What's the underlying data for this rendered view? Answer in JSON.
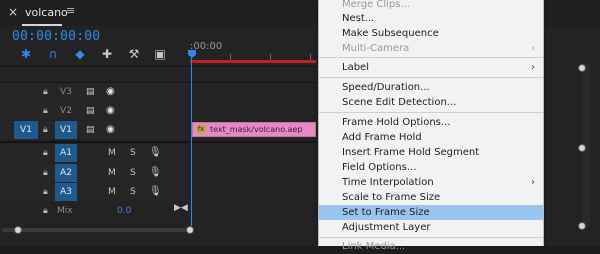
{
  "timeline": {
    "sequence_name": "volcano",
    "timecode": "00:00:00:00",
    "ruler_time": ":00:00",
    "tools": [
      {
        "name": "snap-in-timeline-icon",
        "glyph": "⚹",
        "active": true
      },
      {
        "name": "linked-selection-icon",
        "glyph": "∩",
        "active": true
      },
      {
        "name": "add-marker-icon",
        "glyph": "◆",
        "active": true
      },
      {
        "name": "timeline-display-settings-icon",
        "glyph": "⚑",
        "active": false
      },
      {
        "name": "wrench-icon",
        "glyph": "🔧",
        "active": false
      },
      {
        "name": "captions-icon",
        "glyph": "▭",
        "active": false
      }
    ],
    "video_tracks": [
      {
        "name": "V3",
        "source": "",
        "active": false
      },
      {
        "name": "V2",
        "source": "",
        "active": false
      },
      {
        "name": "V1",
        "source": "V1",
        "active": true
      }
    ],
    "audio_tracks": [
      {
        "name": "A1",
        "mute": "M",
        "solo": "S"
      },
      {
        "name": "A2",
        "mute": "M",
        "solo": "S"
      },
      {
        "name": "A3",
        "mute": "M",
        "solo": "S"
      }
    ],
    "mix_label": "Mix",
    "mix_value": "0.0",
    "clip": {
      "fx": "fx",
      "name": "text_mask/volcano.aep"
    },
    "colors": {
      "accent": "#2d8ceb",
      "clip": "#e58bc4",
      "red_bar": "#c02020"
    }
  },
  "context_menu": {
    "items": [
      {
        "label": "Merge Clips...",
        "disabled": true
      },
      {
        "label": "Nest...",
        "disabled": false
      },
      {
        "label": "Make Subsequence",
        "disabled": false
      },
      {
        "label": "Multi-Camera",
        "disabled": true,
        "submenu": true
      },
      {
        "label": "Label",
        "disabled": false,
        "submenu": true
      },
      {
        "label": "Speed/Duration...",
        "disabled": false
      },
      {
        "label": "Scene Edit Detection...",
        "disabled": false
      },
      {
        "label": "Frame Hold Options...",
        "disabled": false
      },
      {
        "label": "Add Frame Hold",
        "disabled": false
      },
      {
        "label": "Insert Frame Hold Segment",
        "disabled": false
      },
      {
        "label": "Field Options...",
        "disabled": false
      },
      {
        "label": "Time Interpolation",
        "disabled": false,
        "submenu": true
      },
      {
        "label": "Scale to Frame Size",
        "disabled": false
      },
      {
        "label": "Set to Frame Size",
        "disabled": false,
        "highlighted": true
      },
      {
        "label": "Adjustment Layer",
        "disabled": false
      },
      {
        "label": "Link Media...",
        "disabled": true
      }
    ],
    "highlight_color": "#98c4f0"
  }
}
